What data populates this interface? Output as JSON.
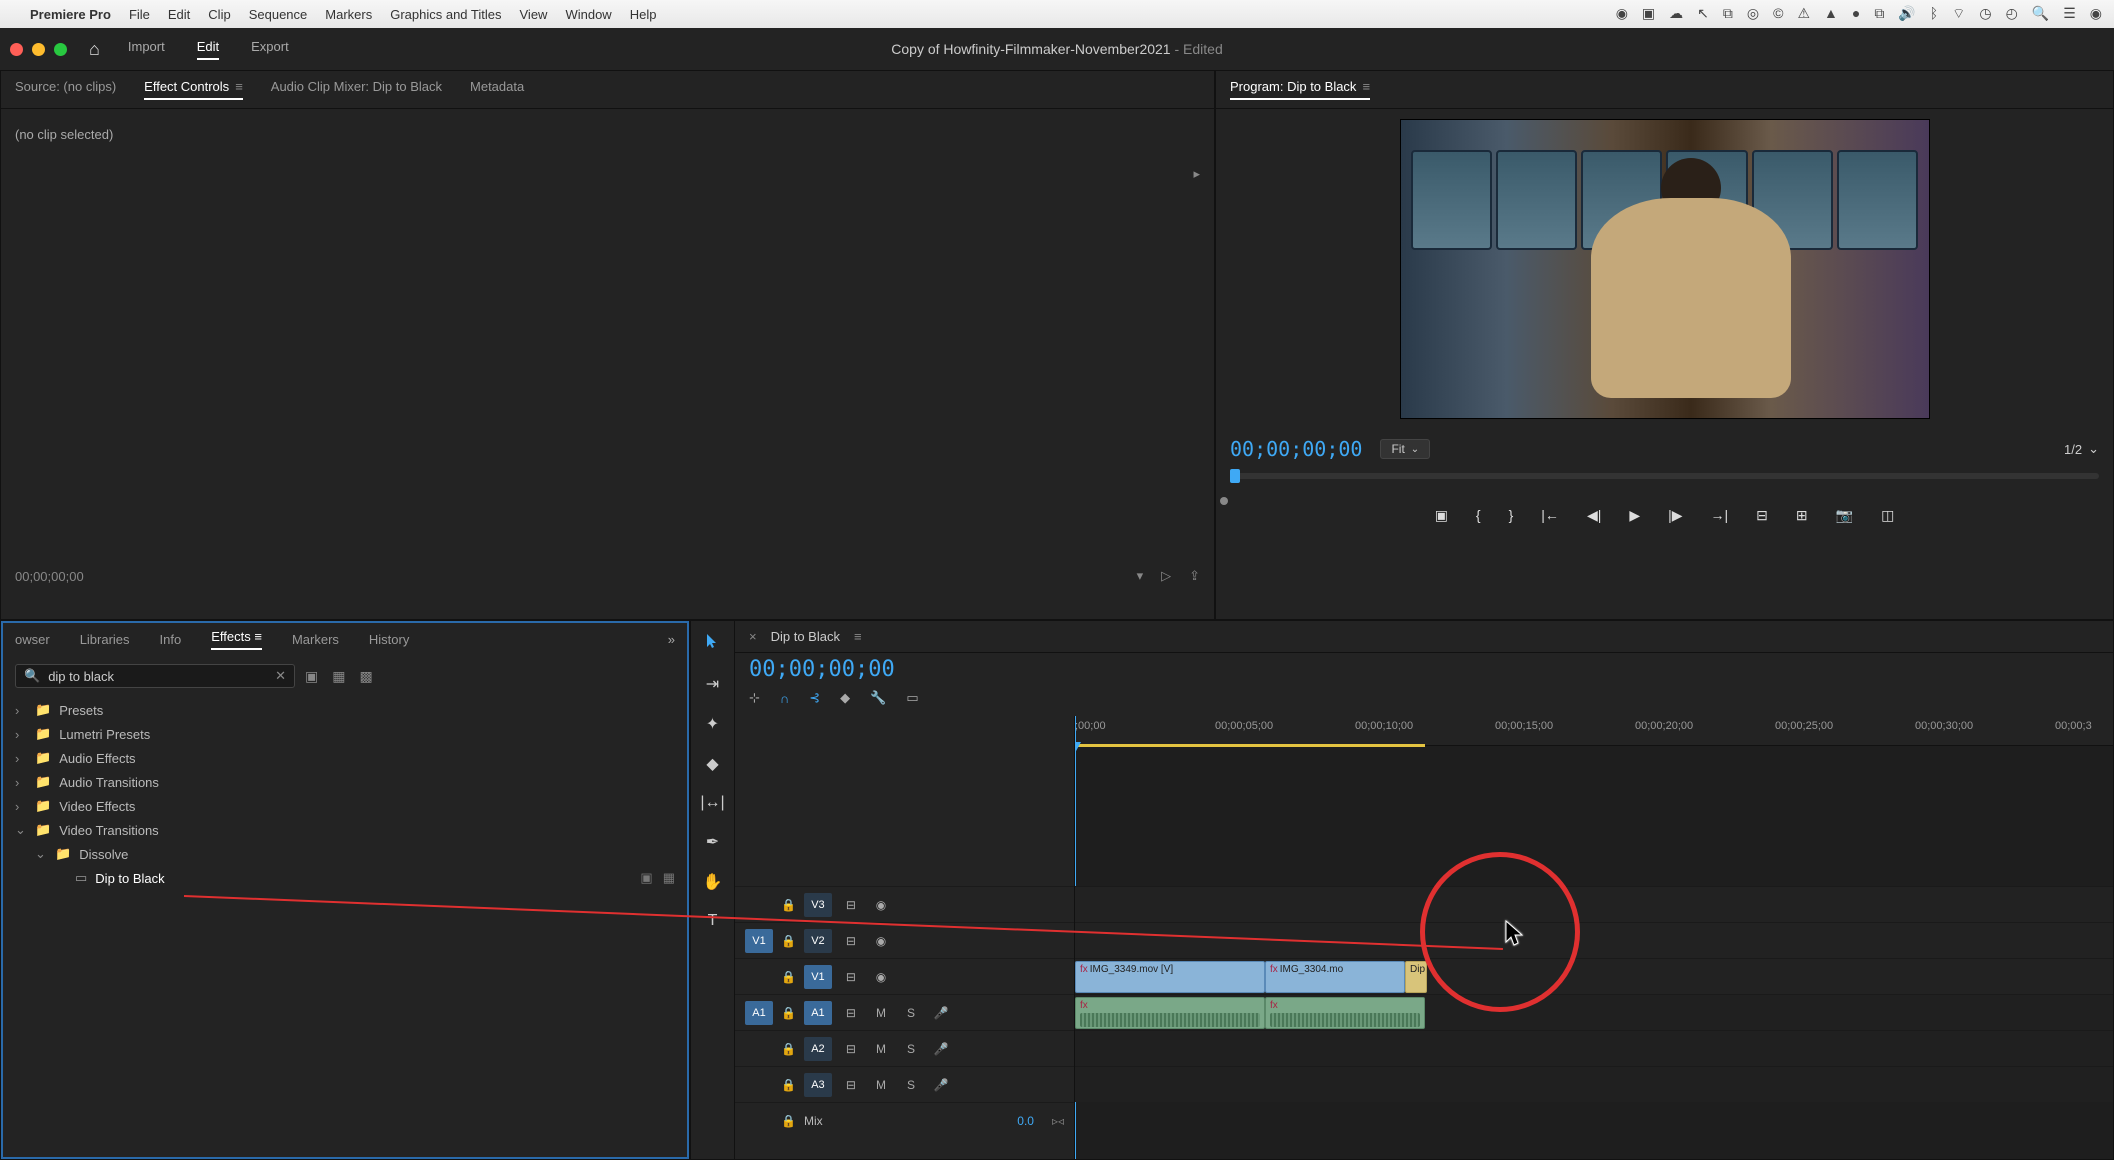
{
  "menubar": {
    "app_name": "Premiere Pro",
    "items": [
      "File",
      "Edit",
      "Clip",
      "Sequence",
      "Markers",
      "Graphics and Titles",
      "View",
      "Window",
      "Help"
    ]
  },
  "window": {
    "title_main": "Copy of Howfinity-Filmmaker-November2021",
    "title_suffix": " - Edited"
  },
  "workspaces": {
    "home": "⌂",
    "items": [
      "Import",
      "Edit",
      "Export"
    ],
    "active": "Edit"
  },
  "source_panel": {
    "tabs": [
      "Source: (no clips)",
      "Effect Controls",
      "Audio Clip Mixer: Dip to Black",
      "Metadata"
    ],
    "active": "Effect Controls",
    "no_clip": "(no clip selected)",
    "timecode": "00;00;00;00"
  },
  "program_panel": {
    "title": "Program: Dip to Black",
    "timecode": "00;00;00;00",
    "fit_label": "Fit",
    "zoom_label": "1/2"
  },
  "effects_panel": {
    "tabs": [
      "owser",
      "Libraries",
      "Info",
      "Effects",
      "Markers",
      "History"
    ],
    "active": "Effects",
    "search_value": "dip to black",
    "tree": [
      {
        "label": "Presets",
        "type": "folder",
        "open": false,
        "indent": 0
      },
      {
        "label": "Lumetri Presets",
        "type": "folder",
        "open": false,
        "indent": 0
      },
      {
        "label": "Audio Effects",
        "type": "folder",
        "open": false,
        "indent": 0
      },
      {
        "label": "Audio Transitions",
        "type": "folder",
        "open": false,
        "indent": 0
      },
      {
        "label": "Video Effects",
        "type": "folder",
        "open": false,
        "indent": 0
      },
      {
        "label": "Video Transitions",
        "type": "folder",
        "open": true,
        "indent": 0
      },
      {
        "label": "Dissolve",
        "type": "folder",
        "open": true,
        "indent": 1
      },
      {
        "label": "Dip to Black",
        "type": "effect",
        "open": false,
        "indent": 2,
        "selected": true
      }
    ]
  },
  "timeline": {
    "sequence_name": "Dip to Black",
    "timecode": "00;00;00;00",
    "ruler": [
      ";00;00",
      "00;00;05;00",
      "00;00;10;00",
      "00;00;15;00",
      "00;00;20;00",
      "00;00;25;00",
      "00;00;30;00",
      "00;00;3"
    ],
    "video_tracks": [
      {
        "name": "V3",
        "src": ""
      },
      {
        "name": "V2",
        "src": ""
      },
      {
        "name": "V1",
        "src": "V1"
      }
    ],
    "audio_tracks": [
      {
        "name": "A1",
        "src": "A1"
      },
      {
        "name": "A2",
        "src": ""
      },
      {
        "name": "A3",
        "src": ""
      }
    ],
    "mix_label": "Mix",
    "mix_value": "0.0",
    "clips": {
      "clip1": "IMG_3349.mov [V]",
      "clip2": "IMG_3304.mo",
      "trans": "Dip"
    },
    "track_toggles": {
      "mute": "M",
      "solo": "S",
      "eye": "◉",
      "sync": "⊟"
    }
  },
  "tools": [
    "▶",
    "⊕",
    "✦",
    "◇",
    "⟷",
    "✎",
    "✋",
    "T"
  ]
}
